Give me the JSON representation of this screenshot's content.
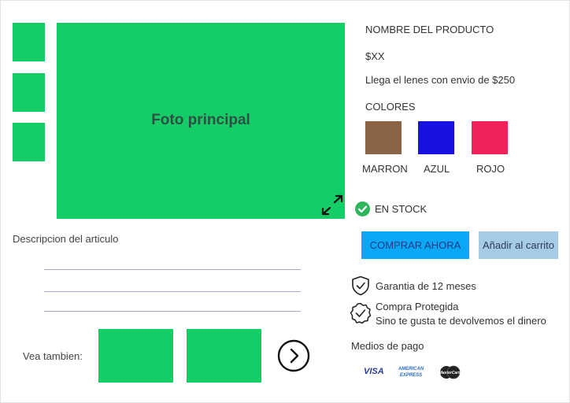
{
  "gallery": {
    "main_photo_label": "Foto principal"
  },
  "description": {
    "title": "Descripcion del articulo",
    "see_also_label": "Vea tambien:"
  },
  "product": {
    "name": "NOMBRE DEL PRODUCTO",
    "price": "$XX",
    "shipping": "Llega el lenes con envio de $250",
    "colors_title": "COLORES",
    "colors": [
      {
        "label": "MARRON",
        "hex": "#8b6446"
      },
      {
        "label": "AZUL",
        "hex": "#1710e0"
      },
      {
        "label": "ROJO",
        "hex": "#f0225a"
      }
    ],
    "stock": "EN STOCK"
  },
  "actions": {
    "buy_now": "COMPRAR AHORA",
    "add_to_cart": "Añadir al carrito"
  },
  "guarantees": {
    "warranty": "Garantia de 12 meses",
    "protected": "Compra Protegida",
    "protected_sub": "Sino te gusta te devolvemos el dinero"
  },
  "payment": {
    "title": "Medios de pago",
    "methods": [
      "VISA",
      "AMERICAN EXPRESS",
      "MasterCard"
    ]
  },
  "theme": {
    "placeholder_green": "#15cd67",
    "buy_blue": "#0aa7f5",
    "cart_blue": "#a6cbe4",
    "stock_green": "#2fb65d"
  }
}
